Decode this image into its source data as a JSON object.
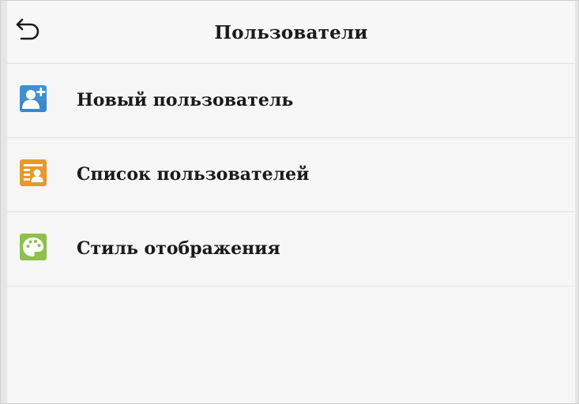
{
  "header": {
    "title": "Пользователи",
    "back_icon": "back-arrow-icon"
  },
  "menu": {
    "items": [
      {
        "label": "Новый пользователь",
        "icon": "add-user-icon",
        "icon_color": "#3f8fd2"
      },
      {
        "label": "Список пользователей",
        "icon": "user-list-icon",
        "icon_color": "#e49a2e"
      },
      {
        "label": "Стиль отображения",
        "icon": "palette-icon",
        "icon_color": "#8cc14c"
      }
    ]
  },
  "colors": {
    "background": "#f6f6f6",
    "divider": "#e2e2e2",
    "text": "#1a1a1a"
  }
}
